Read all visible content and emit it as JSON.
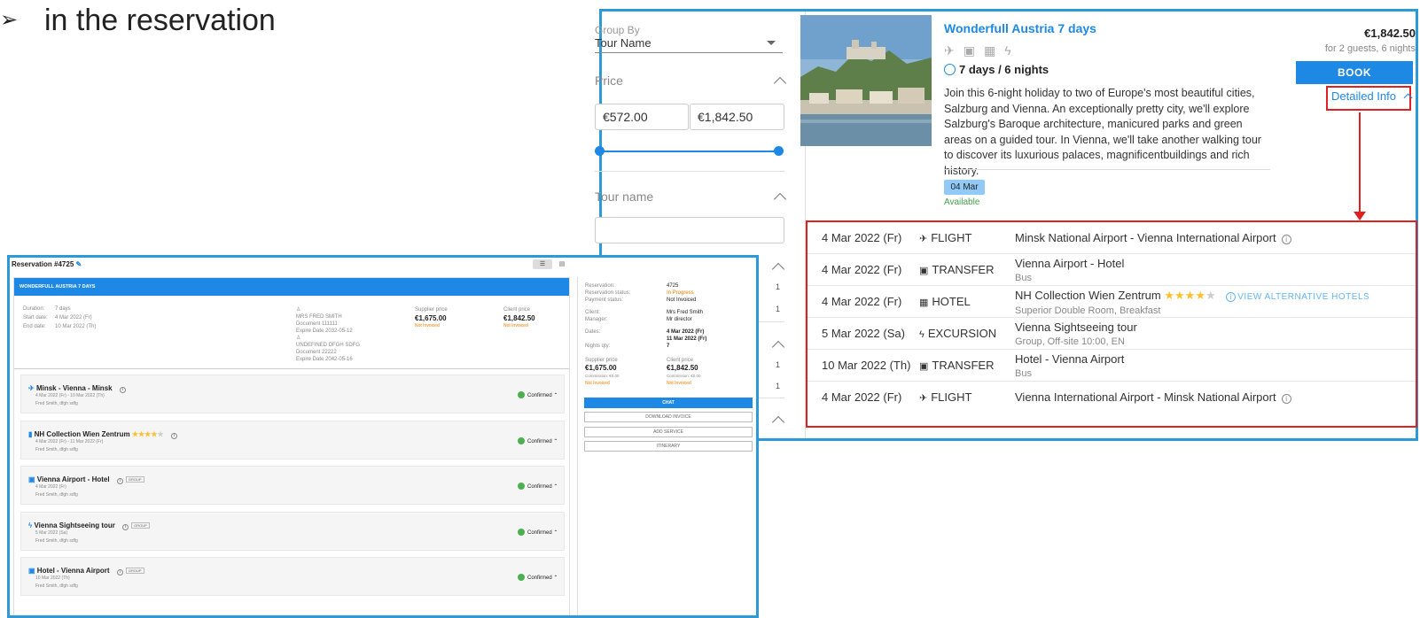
{
  "caption": {
    "bullet": "➢",
    "text": "in the reservation"
  },
  "filters": {
    "group_by_label": "Group By",
    "group_by_value": "Tour Name",
    "price_label": "Price",
    "price_min": "€572.00",
    "price_max": "€1,842.50",
    "tour_name_label": "Tour name"
  },
  "tour": {
    "title": "Wonderfull Austria 7 days",
    "duration": "7 days / 6 nights",
    "description": "Join this 6-night holiday to two of Europe's most beautiful cities, Salzburg and Vienna. An exceptionally pretty city, we'll explore Salzburg's Baroque architecture, manicured parks and green areas on a guided tour. In Vienna, we'll take another walking tour to discover its luxurious palaces, magnificentbuildings and rich history.",
    "price": "€1,842.50",
    "price_note": "for 2 guests, 6 nights",
    "book_label": "BOOK",
    "detailed_info_label": "Detailed Info",
    "date_chip": "04 Mar",
    "availability": "Available",
    "right_counts": [
      "1",
      "1",
      "1",
      "1"
    ]
  },
  "services": [
    {
      "date": "4 Mar 2022 (Fr)",
      "type_icon": "plane-icon",
      "type": "FLIGHT",
      "desc": "Minsk National Airport - Vienna International Airport",
      "sub": "",
      "info": true
    },
    {
      "date": "4 Mar 2022 (Fr)",
      "type_icon": "bus-icon",
      "type": "TRANSFER",
      "desc": "Vienna Airport - Hotel",
      "sub": "Bus",
      "info": false
    },
    {
      "date": "4 Mar 2022 (Fr)",
      "type_icon": "building-icon",
      "type": "HOTEL",
      "desc": "NH Collection Wien Zentrum",
      "sub": "Superior Double Room, Breakfast",
      "info": false,
      "stars": 4,
      "alt_link": "VIEW ALTERNATIVE HOTELS"
    },
    {
      "date": "5 Mar 2022 (Sa)",
      "type_icon": "bolt-icon",
      "type": "EXCURSION",
      "desc": "Vienna Sightseeing tour",
      "sub": "Group, Off-site 10:00, EN",
      "info": false
    },
    {
      "date": "10 Mar 2022 (Th)",
      "type_icon": "bus-icon",
      "type": "TRANSFER",
      "desc": "Hotel - Vienna Airport",
      "sub": "Bus",
      "info": false
    },
    {
      "date": "4 Mar 2022 (Fr)",
      "type_icon": "plane-icon",
      "type": "FLIGHT",
      "desc": "Vienna International Airport - Minsk National Airport",
      "sub": "",
      "info": true
    }
  ],
  "reservation": {
    "title": "Reservation #4725",
    "banner": "WONDERFULL AUSTRIA 7 DAYS",
    "duration_label": "Duration:",
    "duration_value": "7 days",
    "start_label": "Start date:",
    "start_value": "4 Mar 2022 (Fr)",
    "end_label": "End date:",
    "end_value": "10 Mar 2022 (Th)",
    "guest1_name": "MRS FRED SMITH",
    "guest1_doc": "Document 111111",
    "guest1_exp": "Expire Date 2032-05-12",
    "guest2_name": "UNDEFINED DFGH SDFG",
    "guest2_doc": "Document 22222",
    "guest2_exp": "Expire Date 2042-05-16",
    "supplier_label": "Supplier price",
    "supplier_value": "€1,675.00",
    "supplier_status": "Not Invoiced",
    "client_label": "Client price",
    "client_value": "€1,842.50",
    "client_status": "Not Invoiced",
    "cards": [
      {
        "title": "Minsk - Vienna - Minsk",
        "dates": "4 Mar 2022 (Fr) - 10 Mar 2022 (Th)",
        "names": "Fred Smith, dfgh sdfg",
        "status": "Confirmed",
        "group": false
      },
      {
        "title": "NH Collection Wien Zentrum",
        "dates": "4 Mar 2022 (Fr) - 11 Mar 2022 (Fr)",
        "names": "Fred Smith, dfgh sdfg",
        "status": "Confirmed",
        "group": false
      },
      {
        "title": "Vienna Airport - Hotel",
        "dates": "4 Mar 2022 (Fr)",
        "names": "Fred Smith, dfgh sdfg",
        "status": "Confirmed",
        "group": true
      },
      {
        "title": "Vienna Sightseeing tour",
        "dates": "5 Mar 2022 (Sa)",
        "names": "Fred Smith, dfgh sdfg",
        "status": "Confirmed",
        "group": true
      },
      {
        "title": "Hotel - Vienna Airport",
        "dates": "10 Mar 2022 (Th)",
        "names": "Fred Smith, dfgh sdfg",
        "status": "Confirmed",
        "group": true
      }
    ],
    "group_tag": "GROUP",
    "summary": {
      "reservation_label": "Reservation:",
      "reservation_value": "4725",
      "res_status_label": "Reservation status:",
      "res_status_value": "In Progress",
      "pay_status_label": "Payment status:",
      "pay_status_value": "Not Invoiced",
      "client_label": "Client:",
      "client_value": "Mrs Fred Smith",
      "manager_label": "Manager:",
      "manager_value": "Mr director",
      "dates_label": "Dates:",
      "dates_value1": "4 Mar 2022 (Fr)",
      "dates_value2": "11 Mar 2022 (Fr)",
      "nights_label": "Nights qty:",
      "nights_value": "7",
      "supplier_label": "Supplier price",
      "supplier_value": "€1,675.00",
      "client_price_label": "Client price",
      "client_price_value": "€1,842.50",
      "commission1": "Commission: €0.00",
      "commission2": "Commission: €0.00",
      "status1": "Not Invoiced",
      "status2": "Not Invoiced"
    },
    "buttons": {
      "chat": "CHAT",
      "download": "DOWNLOAD INVOICE",
      "add": "ADD SERVICE",
      "itinerary": "ITINERARY"
    }
  },
  "colors": {
    "accent": "#1e88e5",
    "highlight": "#e02020",
    "frame": "#2b9ad6",
    "confirmed": "#4caf50"
  }
}
